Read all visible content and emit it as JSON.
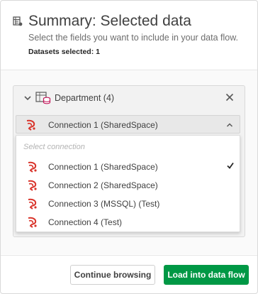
{
  "header": {
    "title": "Summary: Selected data",
    "subtitle": "Select the fields you want to include in your data flow.",
    "datasets_selected": "Datasets selected: 1",
    "icon": "table-list-icon"
  },
  "dataset": {
    "name": "Department (4)",
    "icon": "database-table-icon",
    "selected_connection": "Connection 1 (SharedSpace)"
  },
  "dropdown": {
    "placeholder": "Select connection",
    "options": [
      {
        "label": "Connection 1 (SharedSpace)",
        "selected": true
      },
      {
        "label": "Connection 2 (SharedSpace)",
        "selected": false
      },
      {
        "label": "Connection 3 (MSSQL) (Test)",
        "selected": false
      },
      {
        "label": "Connection 4 (Test)",
        "selected": false
      }
    ]
  },
  "footer": {
    "continue_label": "Continue browsing",
    "load_label": "Load into data flow"
  },
  "colors": {
    "primary": "#009845",
    "connector_icon": "#d9342b"
  }
}
